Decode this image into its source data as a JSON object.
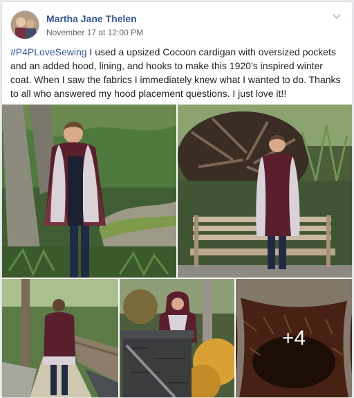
{
  "post": {
    "author": "Martha Jane Thelen",
    "timestamp": "November 17 at 12:00 PM",
    "hashtag": "#P4PLoveSewing",
    "text": " I used a upsized Cocoon cardigan with oversized pockets and an added hood, lining, and hooks to make this 1920’s inspired winter coat. When I saw the fabrics I immediately knew what I wanted to do. Thanks to all who answered my hood placement questions. I just love it!!",
    "more_photos": "+4"
  },
  "icons": {
    "options": "chevron-down-icon"
  },
  "colors": {
    "link": "#365899",
    "text": "#1d2129",
    "meta": "#616770",
    "background": "#e9ebee"
  }
}
